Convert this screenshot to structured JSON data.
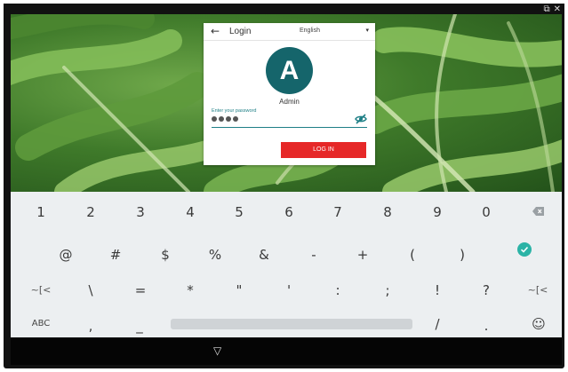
{
  "window_controls": {
    "popout_icon": "external-link-icon",
    "popout_glyph": "⧉",
    "close_icon": "close-icon",
    "close_glyph": "✕"
  },
  "login": {
    "title": "Login",
    "back_glyph": "←",
    "language": "English",
    "dropdown_glyph": "▾",
    "avatar_letter": "A",
    "user_name": "Admin",
    "password_label": "Enter your password",
    "password_masked_count": 4,
    "login_button": "LOG IN"
  },
  "keyboard": {
    "row1": [
      "1",
      "2",
      "3",
      "4",
      "5",
      "6",
      "7",
      "8",
      "9",
      "0"
    ],
    "row2": [
      "@",
      "#",
      "$",
      "%",
      "&",
      "-",
      "+",
      "(",
      ")"
    ],
    "row3": [
      "~[<",
      "\\",
      "=",
      "*",
      "\"",
      "'",
      ":",
      ";",
      "!",
      "?",
      "~[<"
    ],
    "row4": {
      "abc": "ABC",
      "comma": ",",
      "underscore": "_",
      "slash": "/",
      "period": ".",
      "emoji": "☺"
    },
    "backspace_icon": "backspace-icon",
    "done_icon": "check-icon",
    "accent_color": "#2bb3a6"
  },
  "navbar": {
    "home_glyph": "▽"
  },
  "colors": {
    "avatar": "#15656b",
    "login_button": "#e62828",
    "field_accent": "#1e7f86"
  }
}
